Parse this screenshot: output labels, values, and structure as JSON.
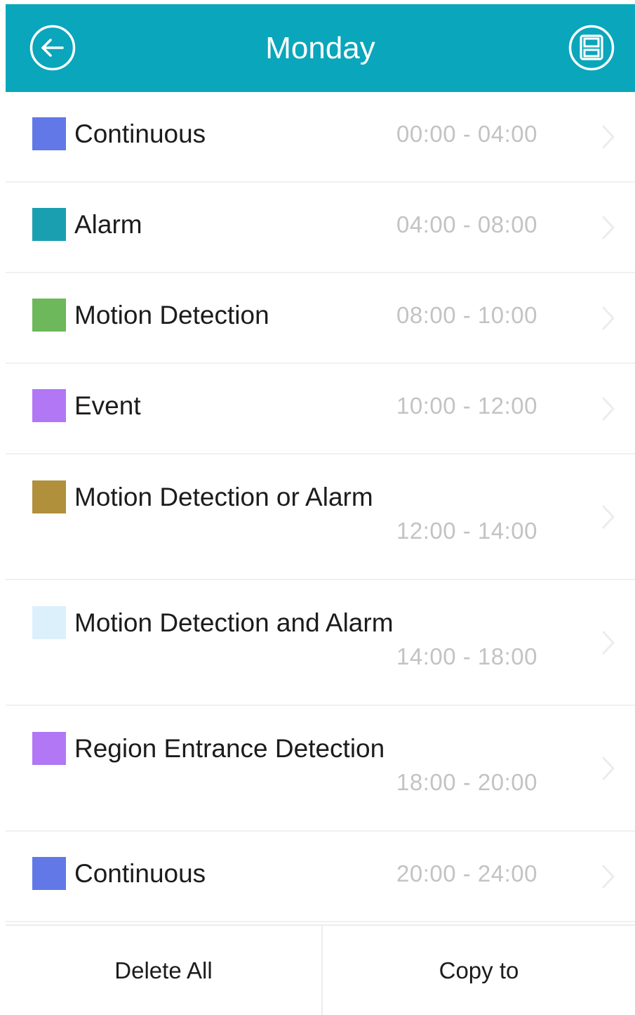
{
  "header": {
    "title": "Monday",
    "background": "#0aa6bb",
    "back_icon": "back-arrow-circle-icon",
    "save_icon": "save-disk-icon"
  },
  "schedule": [
    {
      "label": "Continuous",
      "time": "00:00 - 04:00",
      "color": "#6278e6"
    },
    {
      "label": "Alarm",
      "time": "04:00 - 08:00",
      "color": "#1a9fb0"
    },
    {
      "label": "Motion Detection",
      "time": "08:00 - 10:00",
      "color": "#6cb85a"
    },
    {
      "label": "Event",
      "time": "10:00 - 12:00",
      "color": "#b177f5"
    },
    {
      "label": "Motion Detection or Alarm",
      "time": "12:00 - 14:00",
      "color": "#b0903a"
    },
    {
      "label": "Motion Detection and Alarm",
      "time": "14:00 - 18:00",
      "color": "#dcf0fc"
    },
    {
      "label": "Region Entrance Detection",
      "time": "18:00 - 20:00",
      "color": "#b177f5"
    },
    {
      "label": "Continuous",
      "time": "20:00 - 24:00",
      "color": "#6278e6"
    }
  ],
  "footer": {
    "delete_all_label": "Delete All",
    "copy_to_label": "Copy to"
  }
}
